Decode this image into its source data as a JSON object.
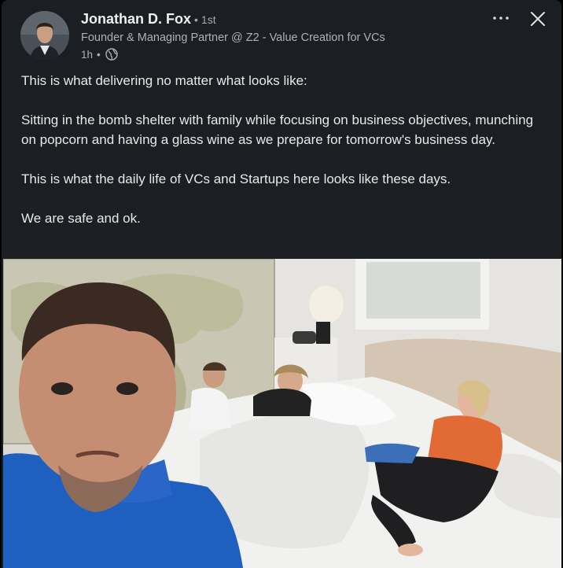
{
  "post": {
    "author": {
      "name": "Jonathan D. Fox",
      "separator": "•",
      "degree": "1st",
      "headline": "Founder & Managing Partner @ Z2 - Value Creation for VCs",
      "time": "1h",
      "time_separator": "•",
      "visibility_icon": "globe-icon"
    },
    "actions": {
      "more_icon": "ellipsis-icon",
      "close_icon": "close-icon"
    },
    "paragraphs": [
      "This is what delivering no matter what looks like:",
      "Sitting in the bomb shelter with family while focusing on business objectives, munching on popcorn and having a glass wine as we prepare for tomorrow's business day.",
      "This is what the daily life of VCs and Startups here looks like these days.",
      "We are safe and ok."
    ]
  },
  "colors": {
    "background": "#1b1f23",
    "text_primary": "#e8e8e8",
    "text_secondary": "#b0b0b0"
  }
}
